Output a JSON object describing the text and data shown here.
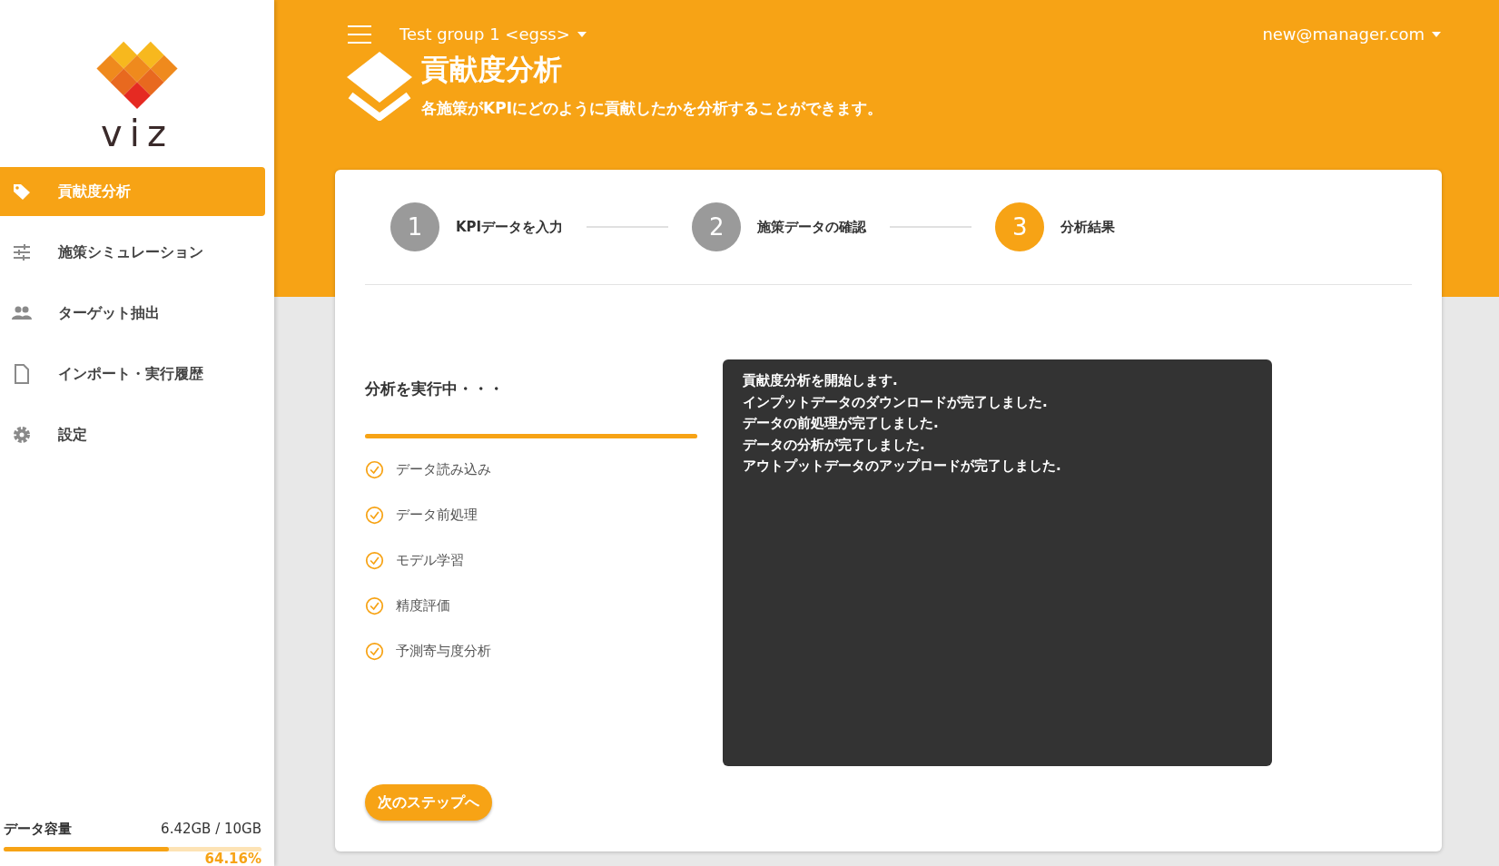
{
  "logo": {
    "text": "viz"
  },
  "sidebar": {
    "items": [
      {
        "label": "貢献度分析",
        "selected": true,
        "kind": "tag"
      },
      {
        "label": "施策シミュレーション",
        "selected": false,
        "kind": "sliders"
      },
      {
        "label": "ターゲット抽出",
        "selected": false,
        "kind": "people"
      },
      {
        "label": "インポート・実行履歴",
        "selected": false,
        "kind": "file"
      },
      {
        "label": "設定",
        "selected": false,
        "kind": "gear"
      }
    ],
    "storage": {
      "label": "データ容量",
      "usage": "6.42GB / 10GB",
      "level": 0.6416,
      "percent": "64.16%"
    }
  },
  "header": {
    "group": "Test group 1 <egss>",
    "user": "new@manager.com",
    "title": "貢献度分析",
    "subtitle": "各施策がKPIにどのように貢献したかを分析することができます。"
  },
  "steps": [
    {
      "number": "1",
      "label": "KPIデータを入力",
      "selected": false
    },
    {
      "number": "2",
      "label": "施策データの確認",
      "selected": false
    },
    {
      "number": "3",
      "label": "分析結果",
      "selected": true
    }
  ],
  "progress": {
    "heading": "分析を実行中・・・",
    "level": 1,
    "tasks": [
      {
        "label": "データ読み込み",
        "done": true
      },
      {
        "label": "データ前処理",
        "done": true
      },
      {
        "label": "モデル学習",
        "done": true
      },
      {
        "label": "精度評価",
        "done": true
      },
      {
        "label": "予測寄与度分析",
        "done": true
      }
    ]
  },
  "log": [
    "貢献度分析を開始します.",
    "インプットデータのダウンロードが完了しました.",
    "データの前処理が完了しました.",
    "データの分析が完了しました.",
    "アウトプットデータのアップロードが完了しました."
  ],
  "next_button": "次のステップへ"
}
